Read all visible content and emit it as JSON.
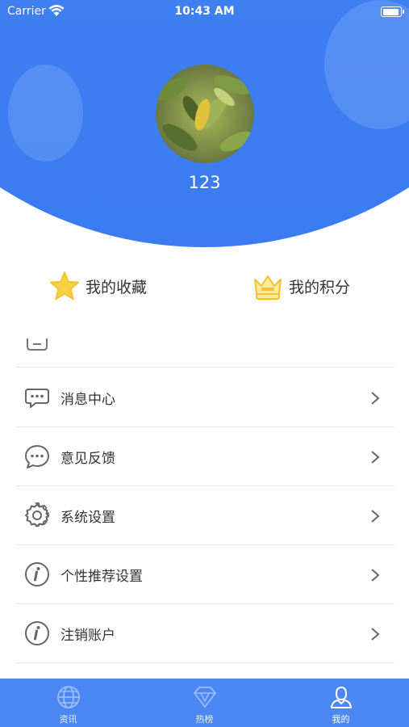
{
  "status_bar": {
    "carrier": "Carrier",
    "time": "10:43 AM",
    "battery_level": 0.95
  },
  "profile": {
    "username": "123"
  },
  "quick_actions": [
    {
      "label": "我的收藏",
      "icon": "star-icon"
    },
    {
      "label": "我的积分",
      "icon": "crown-icon"
    }
  ],
  "menu": [
    {
      "label": "消息中心",
      "icon": "message-icon"
    },
    {
      "label": "意见反馈",
      "icon": "feedback-icon"
    },
    {
      "label": "系统设置",
      "icon": "gear-icon"
    },
    {
      "label": "个性推荐设置",
      "icon": "info-icon"
    },
    {
      "label": "注销账户",
      "icon": "info-icon"
    }
  ],
  "tabs": [
    {
      "label": "资讯",
      "icon": "globe-icon",
      "active": false
    },
    {
      "label": "热榜",
      "icon": "diamond-icon",
      "active": false
    },
    {
      "label": "我的",
      "icon": "user-icon",
      "active": true
    }
  ],
  "colors": {
    "primary": "#4a8ef3",
    "tabbar": "#4c88f3",
    "star": "#f6cf42"
  }
}
